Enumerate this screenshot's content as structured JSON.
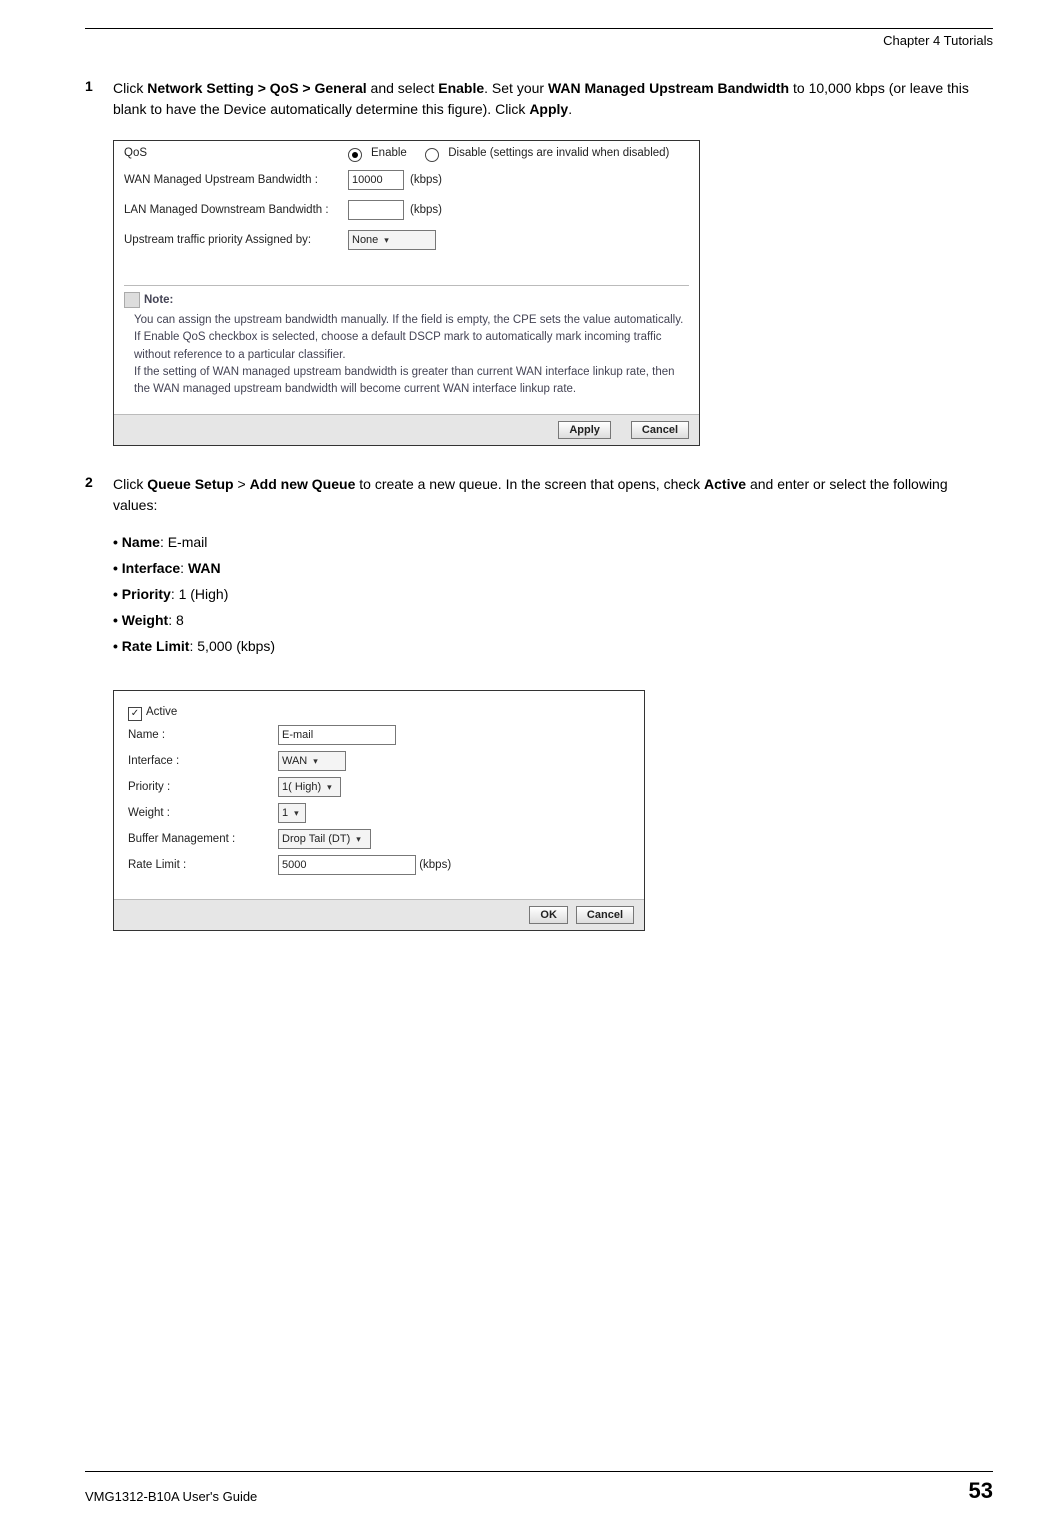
{
  "header": {
    "chapter": "Chapter 4 Tutorials"
  },
  "footer": {
    "guide": "VMG1312-B10A User's Guide",
    "page": "53"
  },
  "step1": {
    "num": "1",
    "t1": "Click ",
    "b1": "Network Setting > QoS > General",
    "t2": " and select ",
    "b2": "Enable",
    "t3": ". Set your ",
    "b3": "WAN Managed Upstream Bandwidth",
    "t4": " to 10,000 kbps (or leave this blank to have the Device automatically determine this figure). Click ",
    "b4": "Apply",
    "t5": "."
  },
  "shot1": {
    "qosLabel": "QoS",
    "enable": "Enable",
    "disable": "Disable (settings are invalid when disabled)",
    "wanLabel": "WAN Managed Upstream Bandwidth :",
    "wanVal": "10000",
    "kbps": "(kbps)",
    "lanLabel": "LAN Managed Downstream Bandwidth :",
    "lanVal": "",
    "prioLabel": "Upstream traffic priority Assigned by:",
    "prioVal": "None",
    "noteTitle": "Note:",
    "noteBody": "You can assign the upstream bandwidth manually. If the field is empty, the CPE sets the value automatically.\nIf Enable QoS checkbox is selected, choose a default DSCP mark to automatically mark incoming traffic without reference to a particular classifier.\nIf the setting of WAN managed upstream bandwidth is greater than current WAN interface linkup rate, then the WAN managed upstream bandwidth will become current WAN interface linkup rate.",
    "apply": "Apply",
    "cancel": "Cancel"
  },
  "step2": {
    "num": "2",
    "t1": "Click ",
    "b1": "Queue Setup",
    "t2": " > ",
    "b2": "Add new Queue",
    "t3": " to create a new queue. In the screen that opens, check ",
    "b3": "Active",
    "t4": " and enter or select the following values:"
  },
  "bullets": {
    "nameK": "Name",
    "nameV": ": E-mail",
    "ifK": "Interface",
    "ifSep": ": ",
    "ifV": "WAN",
    "prK": "Priority",
    "prV": ": 1 (High)",
    "wtK": "Weight",
    "wtV": ": 8",
    "rlK": "Rate Limit",
    "rlV": ": 5,000 (kbps)"
  },
  "shot2": {
    "active": "Active",
    "nameL": "Name :",
    "nameV": "E-mail",
    "ifL": "Interface :",
    "ifV": "WAN",
    "prL": "Priority :",
    "prV": "1( High)",
    "wtL": "Weight :",
    "wtV": "1",
    "bmL": "Buffer Management :",
    "bmV": "Drop Tail (DT)",
    "rlL": "Rate Limit :",
    "rlV": "5000",
    "rlU": "(kbps)",
    "ok": "OK",
    "cancel": "Cancel"
  }
}
